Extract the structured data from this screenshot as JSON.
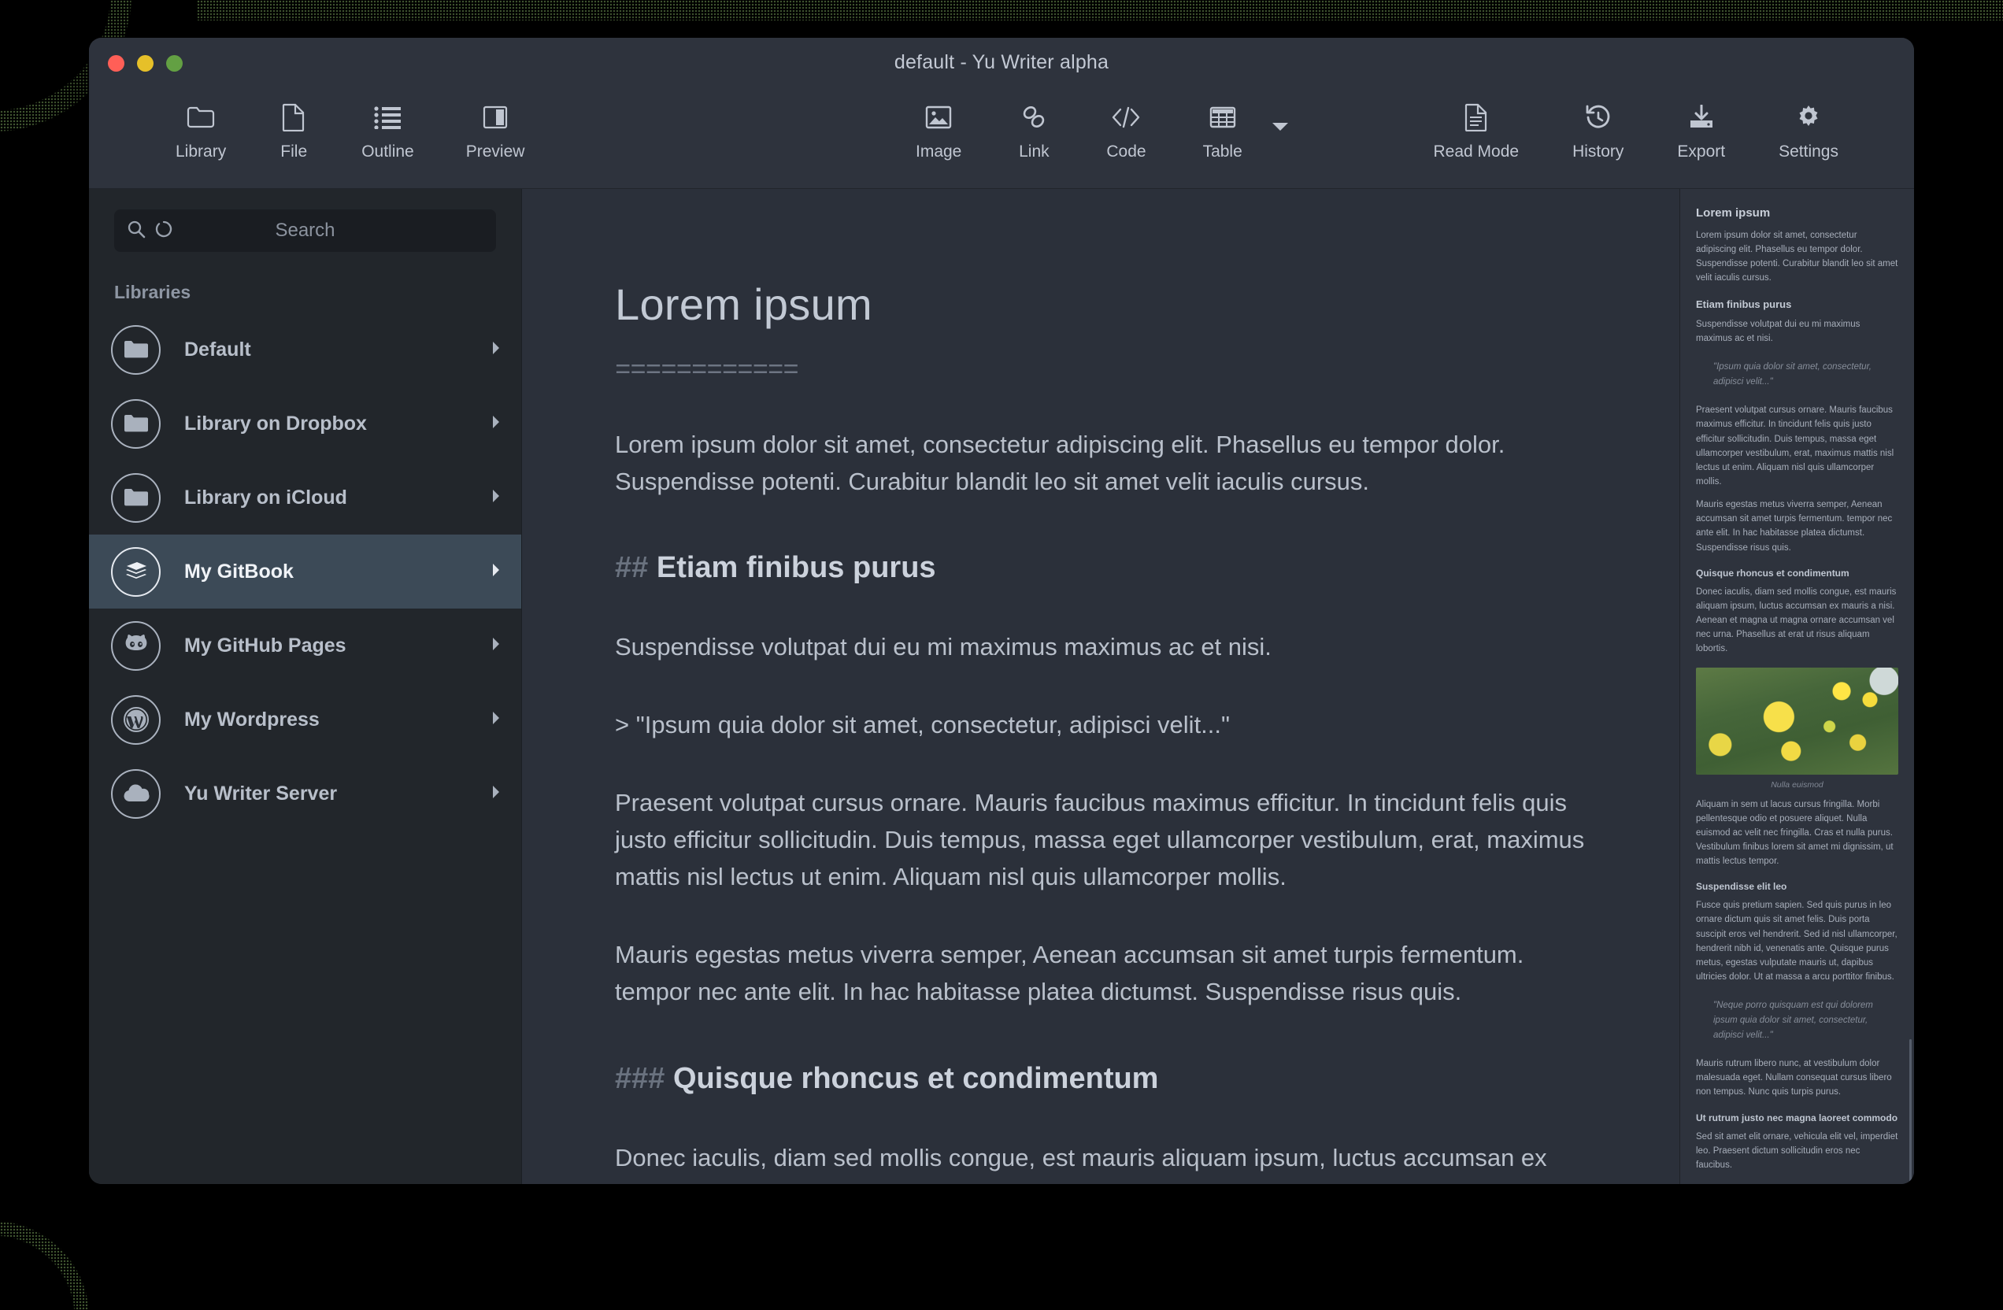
{
  "window": {
    "title": "default - Yu Writer alpha",
    "traffic_lights": [
      "close",
      "minimize",
      "zoom"
    ]
  },
  "toolbar": {
    "left": [
      {
        "label": "Library",
        "icon": "folder-icon"
      },
      {
        "label": "File",
        "icon": "file-icon"
      },
      {
        "label": "Outline",
        "icon": "list-icon"
      },
      {
        "label": "Preview",
        "icon": "preview-panel-icon"
      }
    ],
    "center": [
      {
        "label": "Image",
        "icon": "image-icon"
      },
      {
        "label": "Link",
        "icon": "link-icon"
      },
      {
        "label": "Code",
        "icon": "code-icon"
      },
      {
        "label": "Table",
        "icon": "table-icon"
      }
    ],
    "center_caret": "chevron-down-icon",
    "right": [
      {
        "label": "Read Mode",
        "icon": "document-lines-icon"
      },
      {
        "label": "History",
        "icon": "history-clock-icon"
      },
      {
        "label": "Export",
        "icon": "export-download-icon"
      },
      {
        "label": "Settings",
        "icon": "gear-icon"
      }
    ]
  },
  "sidebar": {
    "search": {
      "placeholder": "Search",
      "value": ""
    },
    "section_title": "Libraries",
    "items": [
      {
        "label": "Default",
        "icon": "folder-icon",
        "selected": false
      },
      {
        "label": "Library on Dropbox",
        "icon": "folder-icon",
        "selected": false
      },
      {
        "label": "Library on iCloud",
        "icon": "folder-icon",
        "selected": false
      },
      {
        "label": "My GitBook",
        "icon": "book-icon",
        "selected": true
      },
      {
        "label": "My GitHub Pages",
        "icon": "github-icon",
        "selected": false
      },
      {
        "label": "My Wordpress",
        "icon": "wordpress-icon",
        "selected": false
      },
      {
        "label": "Yu Writer Server",
        "icon": "cloud-icon",
        "selected": false
      }
    ]
  },
  "editor": {
    "title": "Lorem ipsum",
    "setext_underline": "============",
    "blocks": [
      {
        "type": "paragraph",
        "text": "Lorem ipsum dolor sit amet, consectetur adipiscing elit. Phasellus eu tempor dolor. Suspendisse potenti. Curabitur blandit leo sit amet velit iaculis cursus."
      },
      {
        "type": "h2",
        "marker": "##",
        "text": "Etiam finibus purus"
      },
      {
        "type": "paragraph",
        "text": "Suspendisse volutpat dui eu mi maximus maximus ac et nisi."
      },
      {
        "type": "quote",
        "marker": ">",
        "text": "\"Ipsum quia dolor sit amet, consectetur, adipisci velit...\""
      },
      {
        "type": "paragraph",
        "text": "Praesent volutpat cursus ornare. Mauris faucibus maximus efficitur. In tincidunt felis quis justo efficitur sollicitudin. Duis tempus, massa eget ullamcorper vestibulum, erat, maximus mattis nisl lectus ut enim. Aliquam nisl quis ullamcorper mollis."
      },
      {
        "type": "paragraph",
        "text": "Mauris egestas metus viverra semper, Aenean accumsan sit amet turpis fermentum. tempor nec ante elit. In hac habitasse platea dictumst. Suspendisse risus quis."
      },
      {
        "type": "h3",
        "marker": "###",
        "text": "Quisque rhoncus et condimentum"
      },
      {
        "type": "paragraph",
        "text": "Donec iaculis, diam sed mollis congue, est mauris aliquam ipsum, luctus accumsan ex mauris a nisi. Aenean et magna ut magna ornare accumsan vel nec urna. Phasellus at erat"
      }
    ]
  },
  "preview": {
    "h1": "Lorem ipsum",
    "p1": "Lorem ipsum dolor sit amet, consectetur adipiscing elit. Phasellus eu tempor dolor. Suspendisse potenti. Curabitur blandit leo sit amet velit iaculis cursus.",
    "h2a": "Etiam finibus purus",
    "p2": "Suspendisse volutpat dui eu mi maximus maximus ac et nisi.",
    "quote1": "\"Ipsum quia dolor sit amet, consectetur, adipisci velit...\"",
    "p3": "Praesent volutpat cursus ornare. Mauris faucibus maximus efficitur. In tincidunt felis quis justo efficitur sollicitudin. Duis tempus, massa eget ullamcorper vestibulum, erat, maximus mattis nisl lectus ut enim. Aliquam nisl quis ullamcorper mollis.",
    "p4": "Mauris egestas metus viverra semper, Aenean accumsan sit amet turpis fermentum. tempor nec ante elit. In hac habitasse platea dictumst. Suspendisse risus quis.",
    "h3a": "Quisque rhoncus et condimentum",
    "p5": "Donec iaculis, diam sed mollis congue, est mauris aliquam ipsum, luctus accumsan ex mauris a nisi. Aenean et magna ut magna ornare accumsan vel nec urna. Phasellus at erat ut risus aliquam lobortis.",
    "figure_caption": "Nulla euismod",
    "p6": "Aliquam in sem ut lacus cursus fringilla. Morbi pellentesque odio et posuere aliquet. Nulla euismod ac velit nec fringilla. Cras et nulla purus. Vestibulum finibus lorem sit amet mi dignissim, ut mattis lectus tempor.",
    "h3b": "Suspendisse elit leo",
    "p7": "Fusce quis pretium sapien. Sed quis purus in leo ornare dictum quis sit amet felis. Duis porta suscipit eros vel hendrerit. Sed id nisl ullamcorper, hendrerit nibh id, venenatis ante. Quisque purus metus, egestas vulputate mauris ut, dapibus ultricies dolor. Ut at massa a arcu porttitor finibus.",
    "quote2": "\"Neque porro quisquam est qui dolorem ipsum quia dolor sit amet, consectetur, adipisci velit...\"",
    "p8": "Mauris rutrum libero nunc, at vestibulum dolor malesuada eget. Nullam consequat cursus libero non tempus. Nunc quis turpis purus.",
    "h3c": "Ut rutrum justo nec magna laoreet commodo",
    "p9": "Sed sit amet elit ornare, vehicula elit vel, imperdiet leo. Praesent dictum sollicitudin eros nec faucibus."
  },
  "colors": {
    "window_bg": "#2b303a",
    "titlebar": "#2e333d",
    "sidebar": "#22262b",
    "selection": "#3c4a57",
    "text": "#b9c0cb",
    "muted": "#6d7583",
    "traffic_red": "#ff5f57",
    "traffic_yellow": "#e6c029",
    "traffic_green": "#63a043"
  }
}
